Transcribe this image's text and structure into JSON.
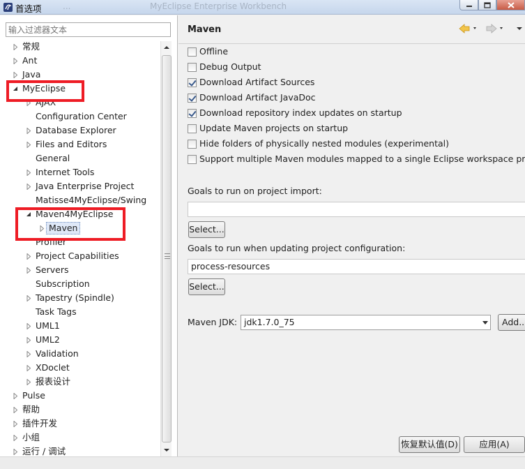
{
  "window": {
    "title": "首选项",
    "ghost_text_1": "...",
    "ghost_text_2": "MyEclipse Enterprise Workbench"
  },
  "filter": {
    "placeholder": "输入过滤器文本"
  },
  "tree": [
    {
      "label": "常规",
      "level": 0,
      "expander": "collapsed"
    },
    {
      "label": "Ant",
      "level": 0,
      "expander": "collapsed"
    },
    {
      "label": "Java",
      "level": 0,
      "expander": "collapsed"
    },
    {
      "label": "MyEclipse",
      "level": 0,
      "expander": "expanded"
    },
    {
      "label": "AJAX",
      "level": 1,
      "expander": "collapsed"
    },
    {
      "label": "Configuration Center",
      "level": 1,
      "expander": "none"
    },
    {
      "label": "Database Explorer",
      "level": 1,
      "expander": "collapsed"
    },
    {
      "label": "Files and Editors",
      "level": 1,
      "expander": "collapsed"
    },
    {
      "label": "General",
      "level": 1,
      "expander": "none"
    },
    {
      "label": "Internet Tools",
      "level": 1,
      "expander": "collapsed"
    },
    {
      "label": "Java Enterprise Project",
      "level": 1,
      "expander": "collapsed"
    },
    {
      "label": "Matisse4MyEclipse/Swing",
      "level": 1,
      "expander": "none"
    },
    {
      "label": "Maven4MyEclipse",
      "level": 1,
      "expander": "expanded"
    },
    {
      "label": "Maven",
      "level": 2,
      "expander": "collapsed",
      "selected": true
    },
    {
      "label": "Profiler",
      "level": 1,
      "expander": "none"
    },
    {
      "label": "Project Capabilities",
      "level": 1,
      "expander": "collapsed"
    },
    {
      "label": "Servers",
      "level": 1,
      "expander": "collapsed"
    },
    {
      "label": "Subscription",
      "level": 1,
      "expander": "none"
    },
    {
      "label": "Tapestry (Spindle)",
      "level": 1,
      "expander": "collapsed"
    },
    {
      "label": "Task Tags",
      "level": 1,
      "expander": "none"
    },
    {
      "label": "UML1",
      "level": 1,
      "expander": "collapsed"
    },
    {
      "label": "UML2",
      "level": 1,
      "expander": "collapsed"
    },
    {
      "label": "Validation",
      "level": 1,
      "expander": "collapsed"
    },
    {
      "label": "XDoclet",
      "level": 1,
      "expander": "collapsed"
    },
    {
      "label": "报表设计",
      "level": 1,
      "expander": "collapsed"
    },
    {
      "label": "Pulse",
      "level": 0,
      "expander": "collapsed"
    },
    {
      "label": "帮助",
      "level": 0,
      "expander": "collapsed"
    },
    {
      "label": "插件开发",
      "level": 0,
      "expander": "collapsed"
    },
    {
      "label": "小组",
      "level": 0,
      "expander": "collapsed"
    },
    {
      "label": "运行 / 调试",
      "level": 0,
      "expander": "collapsed"
    }
  ],
  "page": {
    "title": "Maven",
    "checkboxes": [
      {
        "label": "Offline",
        "checked": false
      },
      {
        "label": "Debug Output",
        "checked": false
      },
      {
        "label": "Download Artifact Sources",
        "checked": true
      },
      {
        "label": "Download Artifact JavaDoc",
        "checked": true
      },
      {
        "label": "Download repository index updates on startup",
        "checked": true
      },
      {
        "label": "Update Maven projects on startup",
        "checked": false
      },
      {
        "label": "Hide folders of physically nested modules (experimental)",
        "checked": false
      },
      {
        "label": "Support multiple Maven modules mapped to a single Eclipse workspace project",
        "checked": false
      }
    ],
    "goals_import_label": "Goals to run on project import:",
    "goals_import_value": "",
    "select_label_1": "Select...",
    "goals_update_label": "Goals to run when updating project configuration:",
    "goals_update_value": "process-resources",
    "select_label_2": "Select...",
    "jdk_label": "Maven JDK:",
    "jdk_value": "jdk1.7.0_75",
    "add_label": "Add...",
    "restore_defaults_label": "恢复默认值(D)",
    "apply_label": "应用(A)"
  },
  "colors": {
    "highlight_red": "#ee1c25",
    "selection_bg": "#dfe8f7"
  }
}
